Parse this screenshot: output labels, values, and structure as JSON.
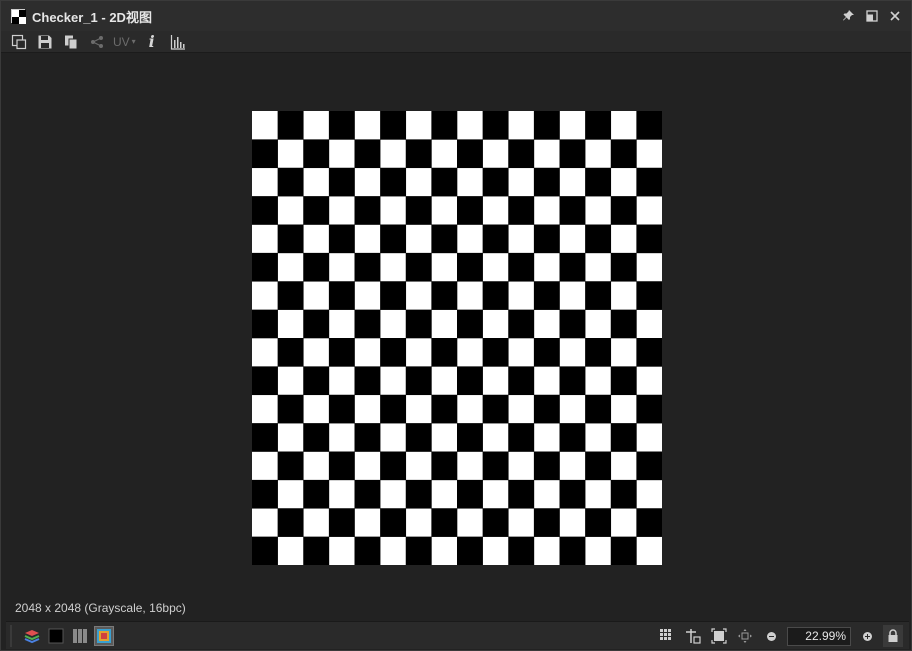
{
  "window": {
    "title": "Checker_1 - 2D视图",
    "icon": "checker-window-icon"
  },
  "title_actions": [
    {
      "name": "pin-icon"
    },
    {
      "name": "float-window-icon"
    },
    {
      "name": "close-icon"
    }
  ],
  "toolbar": {
    "tools": [
      "export-image-icon",
      "save-icon",
      "copy-icon",
      "share-graph-icon"
    ],
    "uv_label": "UV",
    "uv_caret": "▾",
    "info_label": "i",
    "histogram": "histogram-icon"
  },
  "viewport": {
    "image": {
      "cols": 16,
      "rows": 16,
      "colors": {
        "dark": "#000000",
        "light": "#ffffff"
      }
    }
  },
  "status": {
    "info": "2048 x 2048 (Grayscale, 16bpc)"
  },
  "bottom_bar": {
    "left_tools": [
      "layers-icon",
      "black-swatch-icon",
      "channels-icon",
      "view-mode-icon"
    ],
    "right_tools": [
      "grid-icon",
      "tile-icon",
      "fit-view-icon",
      "pan-icon"
    ],
    "zoom": "22.99%",
    "lock": "lock-icon"
  },
  "colors": {
    "background": "#222222",
    "titlebar": "#2d2d2d",
    "icon": "#cfcfcf",
    "disabled": "#6c6c6c"
  }
}
